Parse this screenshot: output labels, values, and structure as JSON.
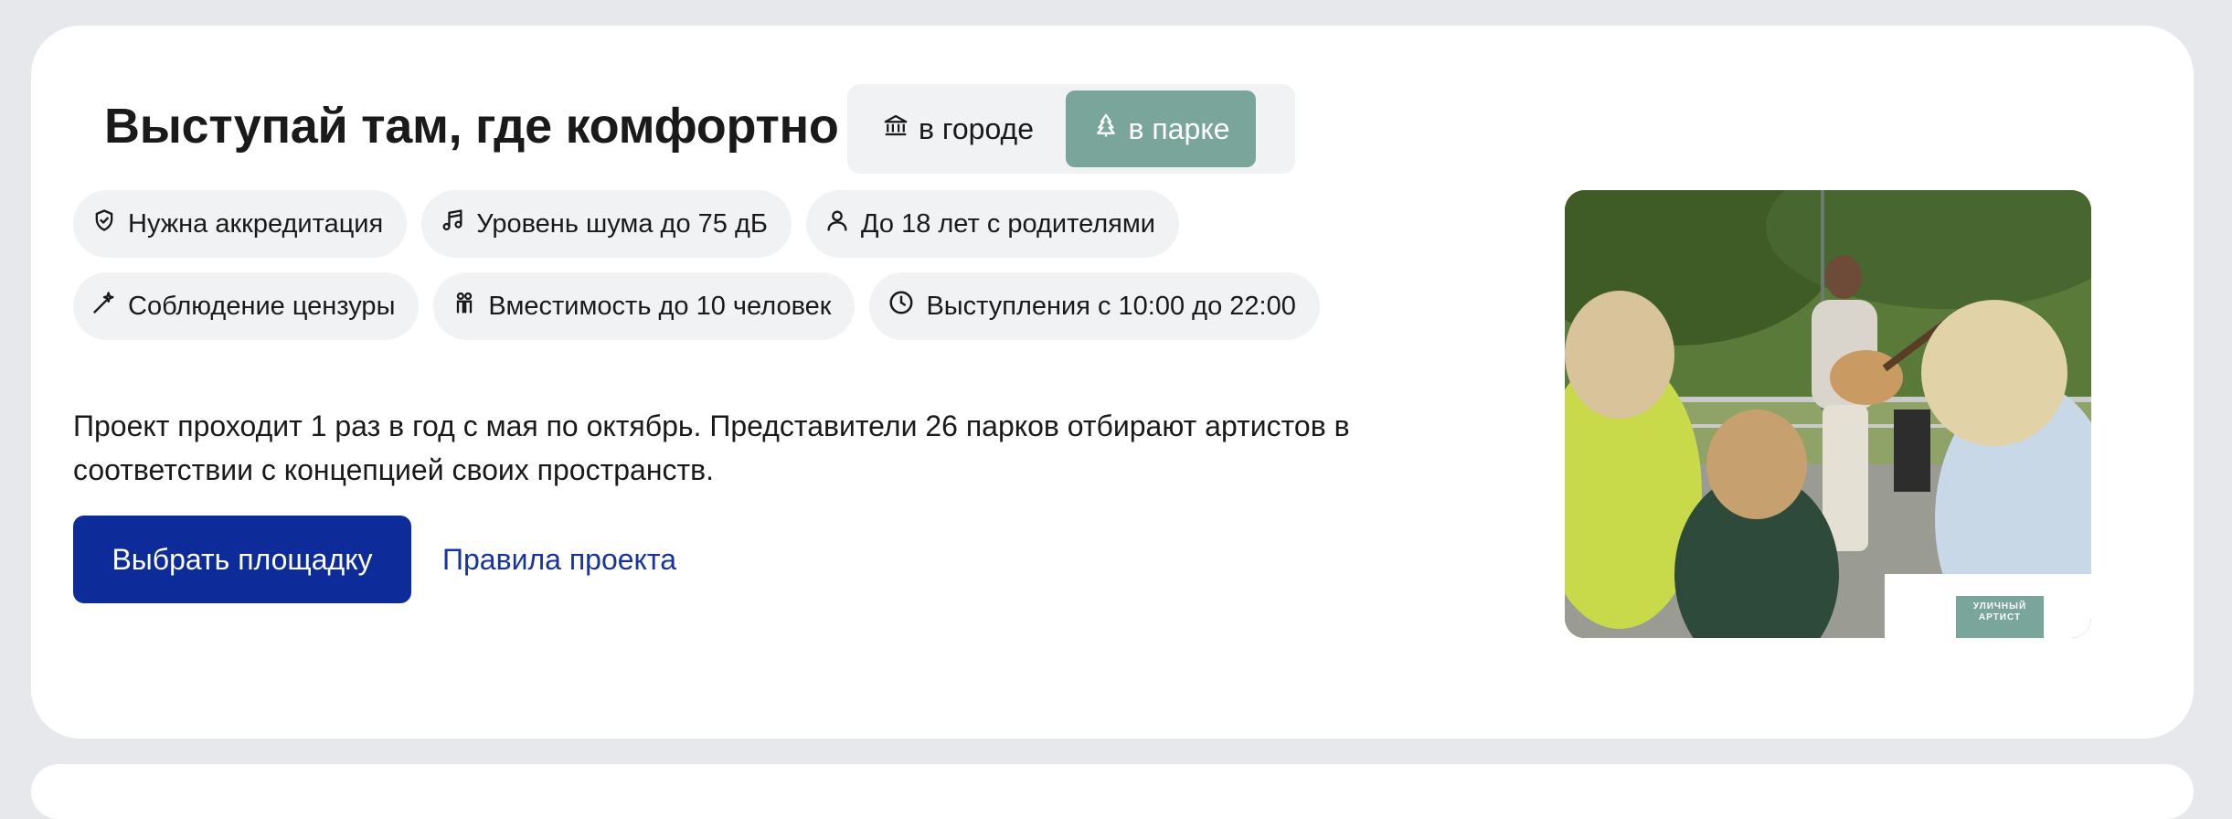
{
  "heading": "Выступай там, где комфортно",
  "toggle": {
    "city_label": "в городе",
    "city_icon": "bank-icon",
    "park_label": "в парке",
    "park_icon": "tree-icon",
    "selected": "в парке"
  },
  "chips": [
    {
      "icon": "shield-check-icon",
      "label": "Нужна аккредитация"
    },
    {
      "icon": "music-note-icon",
      "label": "Уровень шума до 75 дБ"
    },
    {
      "icon": "person-icon",
      "label": "До 18 лет с родителями"
    },
    {
      "icon": "magic-wand-icon",
      "label": "Соблюдение цензуры"
    },
    {
      "icon": "people-icon",
      "label": "Вместимость до 10 человек"
    },
    {
      "icon": "clock-icon",
      "label": "Выступления с 10:00 до 22:00"
    }
  ],
  "description": "Проект проходит 1 раз в год с мая по октябрь. Представители 26 парков отбирают артистов в соответствии с концепцией своих пространств.",
  "actions": {
    "primary_label": "Выбрать площадку",
    "link_label": "Правила проекта"
  },
  "photo": {
    "logo_text": "УЛИЧНЫЙ АРТИСТ"
  },
  "colors": {
    "background": "#e7e8ec",
    "card": "#ffffff",
    "chip_bg": "#f1f2f4",
    "accent_green": "#7aa59a",
    "primary_blue": "#0d2c99",
    "link_blue": "#1733a0"
  }
}
